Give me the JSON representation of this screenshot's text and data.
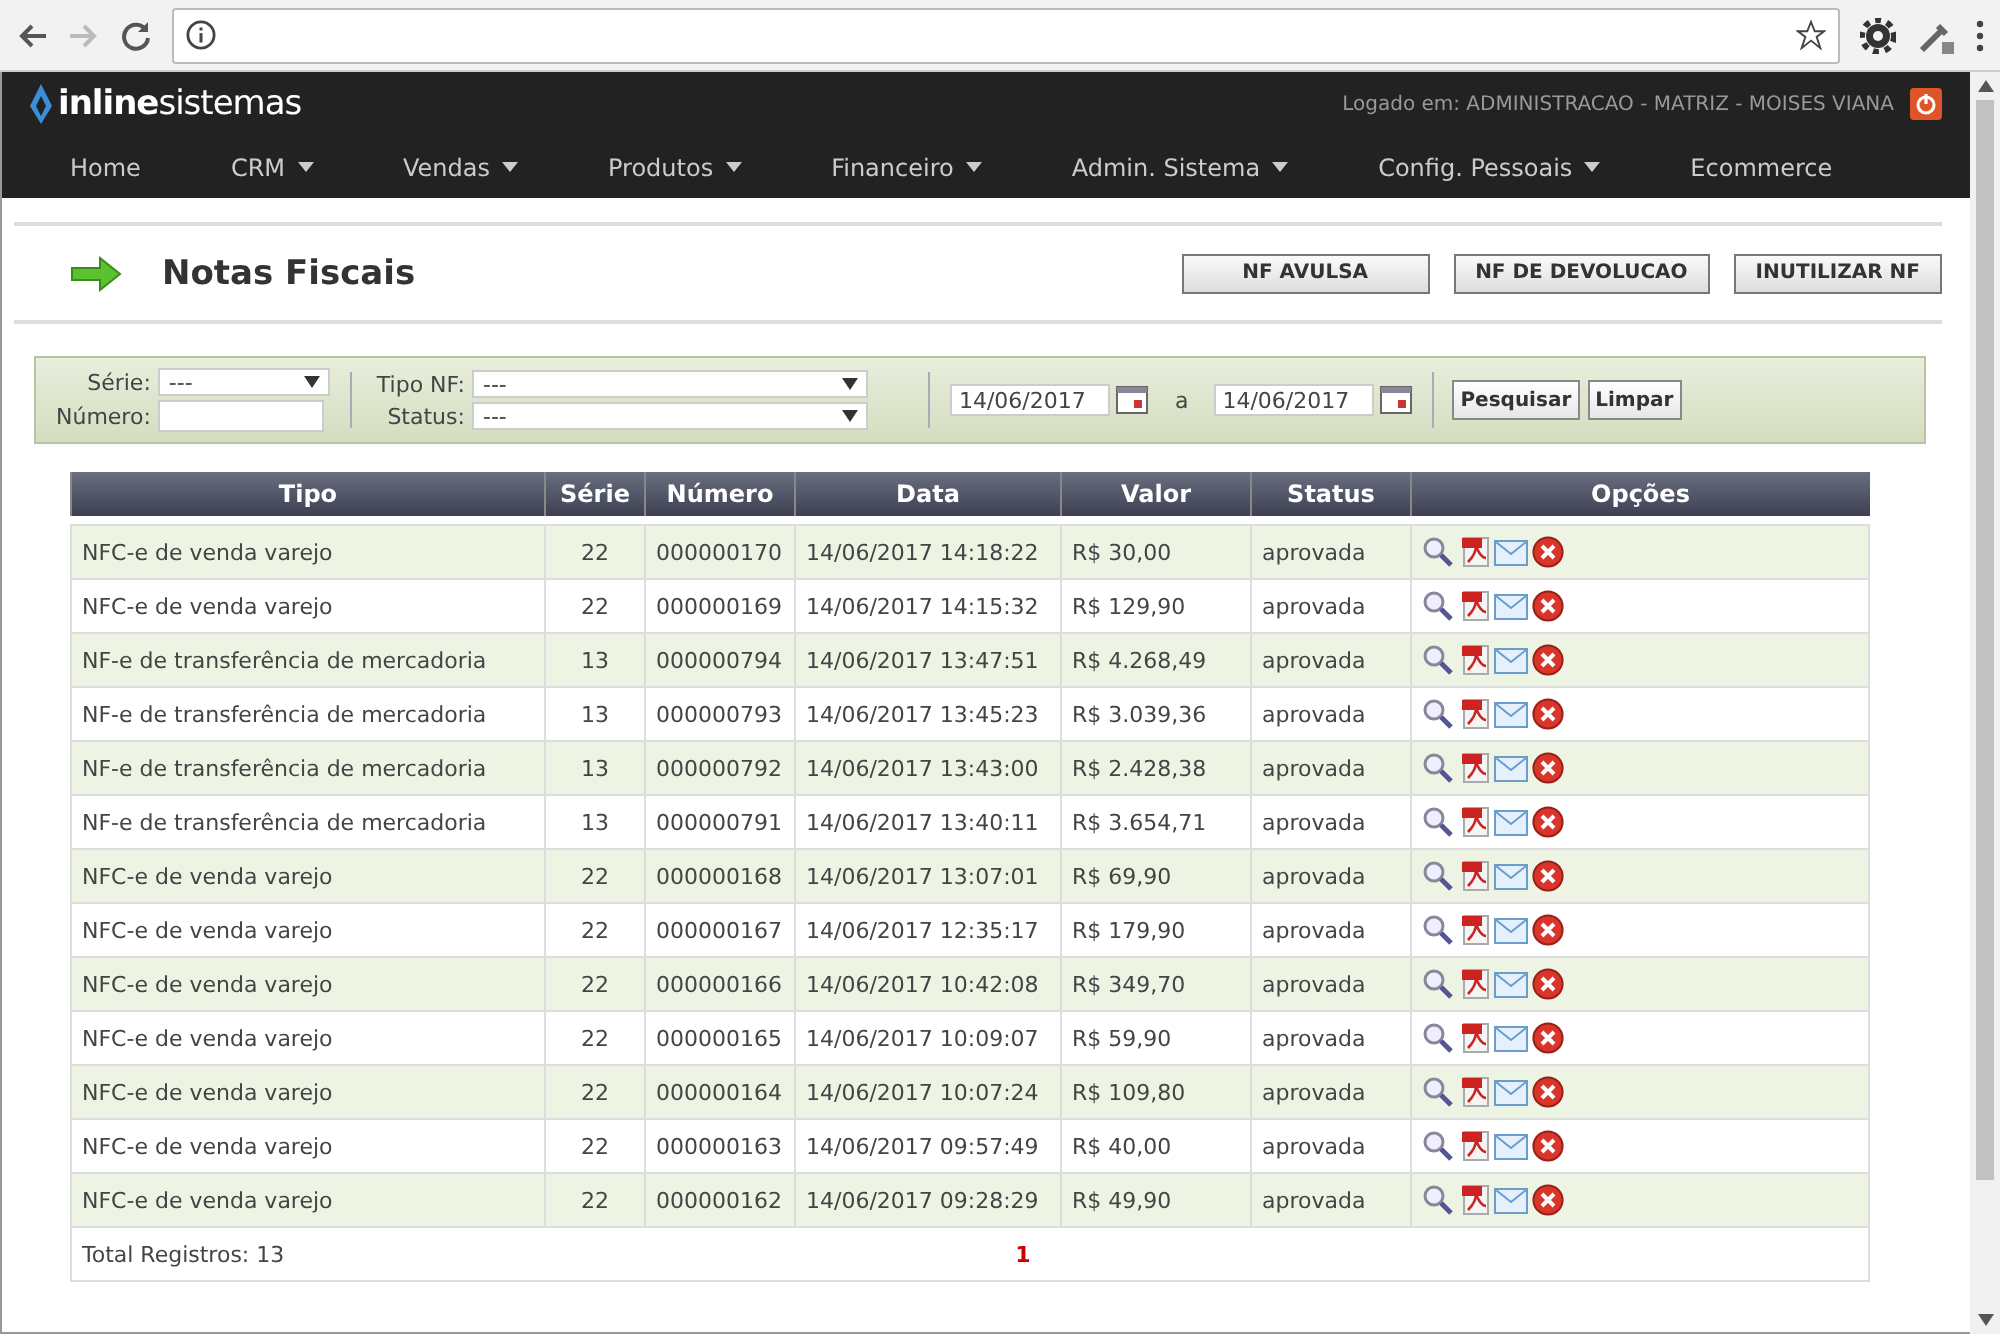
{
  "header": {
    "logo_bold": "inline",
    "logo_light": "sistemas",
    "logged_in": "Logado em: ADMINISTRACAO - MATRIZ - MOISES VIANA"
  },
  "nav": [
    {
      "label": "Home",
      "has_menu": false
    },
    {
      "label": "CRM",
      "has_menu": true
    },
    {
      "label": "Vendas",
      "has_menu": true
    },
    {
      "label": "Produtos",
      "has_menu": true
    },
    {
      "label": "Financeiro",
      "has_menu": true
    },
    {
      "label": "Admin. Sistema",
      "has_menu": true
    },
    {
      "label": "Config. Pessoais",
      "has_menu": true
    },
    {
      "label": "Ecommerce",
      "has_menu": false
    }
  ],
  "page": {
    "title": "Notas Fiscais",
    "buttons": [
      "NF AVULSA",
      "NF DE DEVOLUCAO",
      "INUTILIZAR NF"
    ]
  },
  "filters": {
    "serie_label": "Série:",
    "serie_value": "---",
    "numero_label": "Número:",
    "tipo_label": "Tipo NF:",
    "tipo_value": "---",
    "status_label": "Status:",
    "status_value": "---",
    "date_from": "14/06/2017",
    "date_sep": "a",
    "date_to": "14/06/2017",
    "search_button": "Pesquisar",
    "clear_button": "Limpar"
  },
  "table": {
    "columns": [
      "Tipo",
      "Série",
      "Número",
      "Data",
      "Valor",
      "Status",
      "Opções"
    ],
    "rows": [
      [
        "NFC-e de venda varejo",
        "22",
        "000000170",
        "14/06/2017 14:18:22",
        "R$ 30,00",
        "aprovada"
      ],
      [
        "NFC-e de venda varejo",
        "22",
        "000000169",
        "14/06/2017 14:15:32",
        "R$ 129,90",
        "aprovada"
      ],
      [
        "NF-e de transferência de mercadoria",
        "13",
        "000000794",
        "14/06/2017 13:47:51",
        "R$ 4.268,49",
        "aprovada"
      ],
      [
        "NF-e de transferência de mercadoria",
        "13",
        "000000793",
        "14/06/2017 13:45:23",
        "R$ 3.039,36",
        "aprovada"
      ],
      [
        "NF-e de transferência de mercadoria",
        "13",
        "000000792",
        "14/06/2017 13:43:00",
        "R$ 2.428,38",
        "aprovada"
      ],
      [
        "NF-e de transferência de mercadoria",
        "13",
        "000000791",
        "14/06/2017 13:40:11",
        "R$ 3.654,71",
        "aprovada"
      ],
      [
        "NFC-e de venda varejo",
        "22",
        "000000168",
        "14/06/2017 13:07:01",
        "R$ 69,90",
        "aprovada"
      ],
      [
        "NFC-e de venda varejo",
        "22",
        "000000167",
        "14/06/2017 12:35:17",
        "R$ 179,90",
        "aprovada"
      ],
      [
        "NFC-e de venda varejo",
        "22",
        "000000166",
        "14/06/2017 10:42:08",
        "R$ 349,70",
        "aprovada"
      ],
      [
        "NFC-e de venda varejo",
        "22",
        "000000165",
        "14/06/2017 10:09:07",
        "R$ 59,90",
        "aprovada"
      ],
      [
        "NFC-e de venda varejo",
        "22",
        "000000164",
        "14/06/2017 10:07:24",
        "R$ 109,80",
        "aprovada"
      ],
      [
        "NFC-e de venda varejo",
        "22",
        "000000163",
        "14/06/2017 09:57:49",
        "R$ 40,00",
        "aprovada"
      ],
      [
        "NFC-e de venda varejo",
        "22",
        "000000162",
        "14/06/2017 09:28:29",
        "R$ 49,90",
        "aprovada"
      ]
    ],
    "total": "Total Registros: 13",
    "pages": [
      {
        "label": "1",
        "selected": true
      }
    ]
  }
}
